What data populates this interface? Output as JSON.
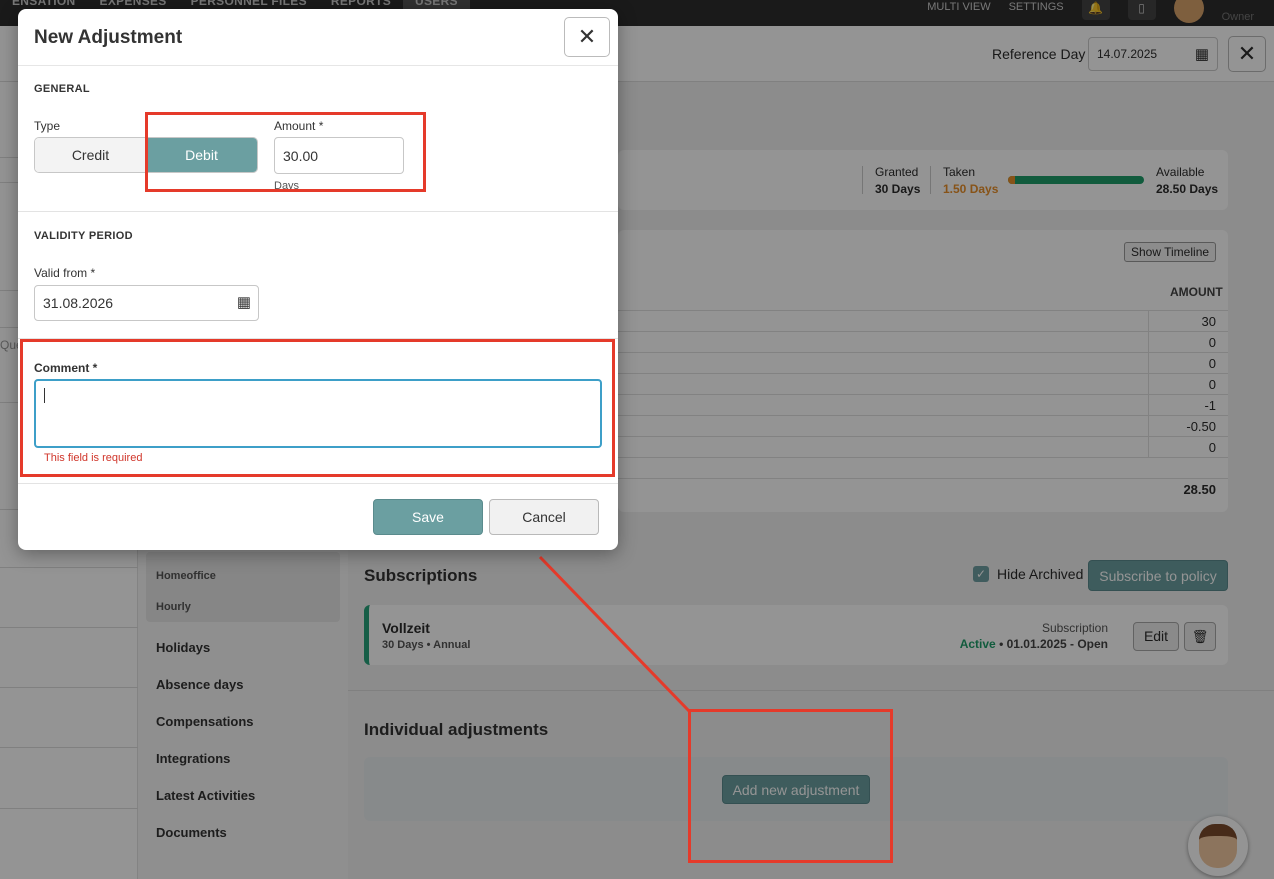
{
  "topbar": {
    "nav": [
      "ENSATION",
      "EXPENSES",
      "PERSONNEL FILES",
      "REPORTS",
      "USERS"
    ],
    "multi_view": "MULTI VIEW",
    "settings": "SETTINGS",
    "user_role": "Owner"
  },
  "header": {
    "reference_day_label": "Reference Day",
    "reference_day_value": "14.07.2025"
  },
  "left_strip": {
    "partial_text": "Que"
  },
  "sidebar": {
    "sub_items": [
      "Homeoffice",
      "Hourly"
    ],
    "items": [
      "Holidays",
      "Absence days",
      "Compensations",
      "Integrations",
      "Latest Activities",
      "Documents"
    ]
  },
  "stats": {
    "granted_label": "Granted",
    "granted_value": "30 Days",
    "taken_label": "Taken",
    "taken_value": "1.50 Days",
    "available_label": "Available",
    "available_value": "28.50 Days",
    "taken_fraction": 0.05
  },
  "table": {
    "show_timeline": "Show Timeline",
    "amount_header": "AMOUNT",
    "amounts": [
      "30",
      "0",
      "0",
      "0",
      "-1",
      "-0.50",
      "0"
    ],
    "total": "28.50"
  },
  "subscriptions": {
    "title": "Subscriptions",
    "hide_archived": "Hide Archived",
    "subscribe_button": "Subscribe to policy",
    "item": {
      "name": "Vollzeit",
      "meta": "30 Days • Annual",
      "label": "Subscription",
      "status": "Active",
      "period": " • 01.01.2025 - Open",
      "edit": "Edit"
    }
  },
  "individual": {
    "title": "Individual adjustments",
    "add_button": "Add new adjustment"
  },
  "modal": {
    "title": "New Adjustment",
    "general_title": "GENERAL",
    "type_label": "Type",
    "credit": "Credit",
    "debit": "Debit",
    "amount_label": "Amount *",
    "amount_value": "30.00",
    "unit": "Days",
    "validity_title": "VALIDITY PERIOD",
    "valid_from_label": "Valid from *",
    "valid_from_value": "31.08.2026",
    "comment_label": "Comment *",
    "comment_value": "",
    "error": "This field is required",
    "save": "Save",
    "cancel": "Cancel"
  },
  "colors": {
    "accent": "#6b9fa1",
    "annotation": "#e53a2a",
    "error": "#d0352a",
    "active": "#1e9e6a",
    "taken": "#e8902a"
  }
}
